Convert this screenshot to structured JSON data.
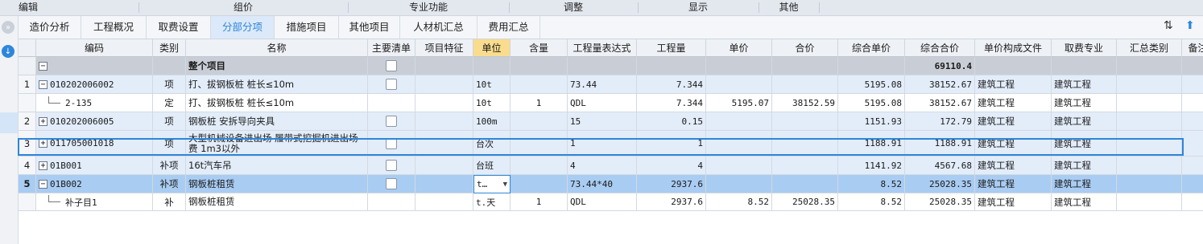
{
  "menubar": [
    "编辑",
    "组价",
    "专业功能",
    "调整",
    "显示",
    "其他"
  ],
  "tabs": [
    {
      "label": "造价分析",
      "active": false
    },
    {
      "label": "工程概况",
      "active": false
    },
    {
      "label": "取费设置",
      "active": false
    },
    {
      "label": "分部分项",
      "active": true
    },
    {
      "label": "措施项目",
      "active": false
    },
    {
      "label": "其他项目",
      "active": false
    },
    {
      "label": "人材机汇总",
      "active": false
    },
    {
      "label": "费用汇总",
      "active": false
    }
  ],
  "left_rail": {
    "icons": [
      "collapse-icon",
      "download-icon"
    ]
  },
  "toolbar_icons": [
    "sort-icon",
    "up-arrow-icon"
  ],
  "colors": {
    "accent": "#2e86d9",
    "row_blue": "#e3edfa",
    "row_white": "#ffffff",
    "row_selected": "#a9ccf2",
    "header": "#eef1f5",
    "header_selected": "#f9dc8e"
  },
  "table": {
    "columns": [
      "",
      "编码",
      "类别",
      "名称",
      "主要清单",
      "项目特征",
      "单位",
      "含量",
      "工程量表达式",
      "工程量",
      "单价",
      "合价",
      "综合单价",
      "综合合价",
      "单价构成文件",
      "取费专业",
      "汇总类别",
      "备注"
    ],
    "selected_column": "单位",
    "summary": {
      "name": "整个项目",
      "total": "69110.4"
    },
    "rows": [
      {
        "no": "1",
        "code": "010202006002",
        "cat": "项",
        "name": "打、拔钢板桩 桩长≤10m",
        "main_check": true,
        "unit": "10t",
        "qty_ratio": "",
        "expr": "73.44",
        "qty": "7.344",
        "price": "",
        "total": "",
        "comp_price": "5195.08",
        "comp_total": "38152.67",
        "file": "建筑工程",
        "fee": "建筑工程",
        "toggle": "−",
        "level": 0
      },
      {
        "no": "",
        "code": "2-135",
        "cat": "定",
        "name": "打、拔钢板桩 桩长≤10m",
        "main_check": false,
        "unit": "10t",
        "qty_ratio": "1",
        "expr": "QDL",
        "qty": "7.344",
        "price": "5195.07",
        "total": "38152.59",
        "comp_price": "5195.08",
        "comp_total": "38152.67",
        "file": "建筑工程",
        "fee": "建筑工程",
        "toggle": "",
        "level": 1
      },
      {
        "no": "2",
        "code": "010202006005",
        "cat": "项",
        "name": "钢板桩 安拆导向夹具",
        "main_check": true,
        "unit": "100m",
        "qty_ratio": "",
        "expr": "15",
        "qty": "0.15",
        "price": "",
        "total": "",
        "comp_price": "1151.93",
        "comp_total": "172.79",
        "file": "建筑工程",
        "fee": "建筑工程",
        "toggle": "+",
        "level": 0
      },
      {
        "no": "3",
        "code": "011705001018",
        "cat": "项",
        "name": "大型机械设备进出场 履带式挖掘机进出场费 1m3以外",
        "main_check": true,
        "unit": "台次",
        "qty_ratio": "",
        "expr": "1",
        "qty": "1",
        "price": "",
        "total": "",
        "comp_price": "1188.91",
        "comp_total": "1188.91",
        "file": "建筑工程",
        "fee": "建筑工程",
        "toggle": "+",
        "level": 0
      },
      {
        "no": "4",
        "code": "01B001",
        "cat": "补项",
        "name": "16t汽车吊",
        "main_check": true,
        "unit": "台班",
        "qty_ratio": "",
        "expr": "4",
        "qty": "4",
        "price": "",
        "total": "",
        "comp_price": "1141.92",
        "comp_total": "4567.68",
        "file": "建筑工程",
        "fee": "建筑工程",
        "toggle": "+",
        "level": 0
      },
      {
        "no": "5",
        "code": "01B002",
        "cat": "补项",
        "name": "钢板桩租赁",
        "main_check": true,
        "unit": "t…",
        "qty_ratio": "",
        "expr": "73.44*40",
        "qty": "2937.6",
        "price": "",
        "total": "",
        "comp_price": "8.52",
        "comp_total": "25028.35",
        "file": "建筑工程",
        "fee": "建筑工程",
        "toggle": "−",
        "level": 0,
        "selected": true
      },
      {
        "no": "",
        "code": "补子目1",
        "cat": "补",
        "name": "钢板桩租赁",
        "main_check": false,
        "unit": "t.天",
        "qty_ratio": "1",
        "expr": "QDL",
        "qty": "2937.6",
        "price": "8.52",
        "total": "25028.35",
        "comp_price": "8.52",
        "comp_total": "25028.35",
        "file": "建筑工程",
        "fee": "建筑工程",
        "toggle": "",
        "level": 1
      }
    ]
  }
}
